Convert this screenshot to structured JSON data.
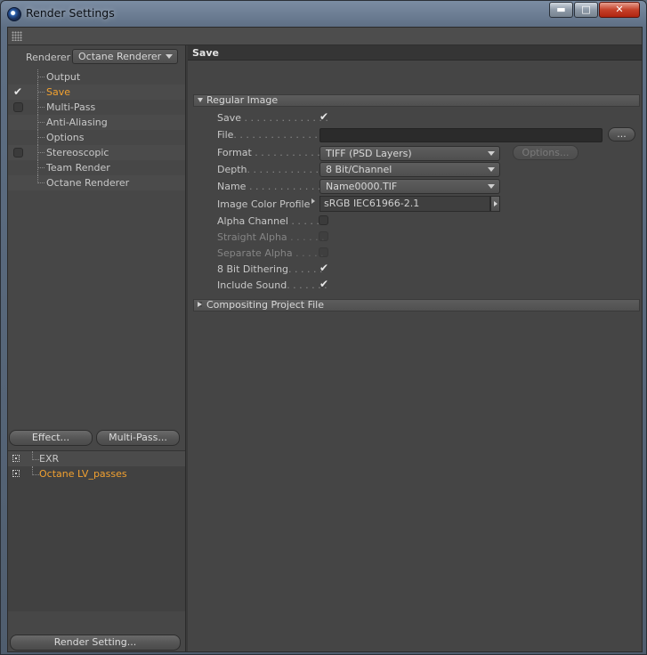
{
  "window": {
    "title": "Render Settings",
    "controls": {
      "minimize": "▬",
      "maximize": "□",
      "close": "✕"
    }
  },
  "left": {
    "renderer_label": "Renderer",
    "renderer_value": "Octane Renderer",
    "nav": [
      {
        "label": "Output",
        "checkbox": false,
        "checked": false,
        "active": false
      },
      {
        "label": "Save",
        "checkbox": false,
        "checked": true,
        "active": true
      },
      {
        "label": "Multi-Pass",
        "checkbox": true,
        "checked": false,
        "active": false
      },
      {
        "label": "Anti-Aliasing",
        "checkbox": false,
        "checked": false,
        "active": false
      },
      {
        "label": "Options",
        "checkbox": false,
        "checked": false,
        "active": false
      },
      {
        "label": "Stereoscopic",
        "checkbox": true,
        "checked": false,
        "active": false
      },
      {
        "label": "Team Render",
        "checkbox": false,
        "checked": false,
        "active": false
      },
      {
        "label": "Octane Renderer",
        "checkbox": false,
        "checked": false,
        "active": false
      }
    ],
    "effect_button": "Effect...",
    "multipass_button": "Multi-Pass...",
    "effects": [
      {
        "label": "EXR",
        "active": false
      },
      {
        "label": "Octane LV_passes",
        "active": true
      }
    ],
    "render_setting_button": "Render Setting..."
  },
  "panel": {
    "title": "Save",
    "regular_image_header": "Regular Image",
    "props": {
      "save": {
        "label": "Save",
        "dots": " . . . . . . . . . . . . . .",
        "checked": true
      },
      "file": {
        "label": "File",
        "dots": ". . . . . . . . . . . . . . .",
        "value": ""
      },
      "format": {
        "label": "Format",
        "dots": " . . . . . . . . . . . . .",
        "value": "TIFF (PSD Layers)"
      },
      "depth": {
        "label": "Depth",
        "dots": ". . . . . . . . . . . . . .",
        "value": "8 Bit/Channel"
      },
      "name": {
        "label": "Name",
        "dots": " . . . . . . . . . . . . . .",
        "value": "Name0000.TIF"
      },
      "profile": {
        "label": "Image Color Profile",
        "value": "sRGB IEC61966-2.1"
      },
      "alpha": {
        "label": "Alpha Channel",
        "dots": " . . . . .",
        "checked": false
      },
      "straight": {
        "label": "Straight Alpha",
        "dots": " . . . . . .",
        "checked": false
      },
      "separate": {
        "label": "Separate Alpha",
        "dots": " . . . . .",
        "checked": false
      },
      "dither": {
        "label": "8 Bit Dithering",
        "dots": ". . . . . .",
        "checked": true
      },
      "sound": {
        "label": "Include Sound",
        "dots": ". . . . . . .",
        "checked": true
      }
    },
    "ellipsis_button": "...",
    "options_button": "Options...",
    "compositing_header": "Compositing Project File"
  },
  "colors": {
    "accent_active": "#f2a130",
    "panel_bg": "#454545",
    "title_bar": "#6a7c92",
    "close_button": "#c5412a"
  },
  "icons": {
    "app": "cinema4d-app-icon",
    "grip": "panel-grip-icon",
    "check": "checkmark-icon",
    "effect": "effect-node-icon"
  }
}
